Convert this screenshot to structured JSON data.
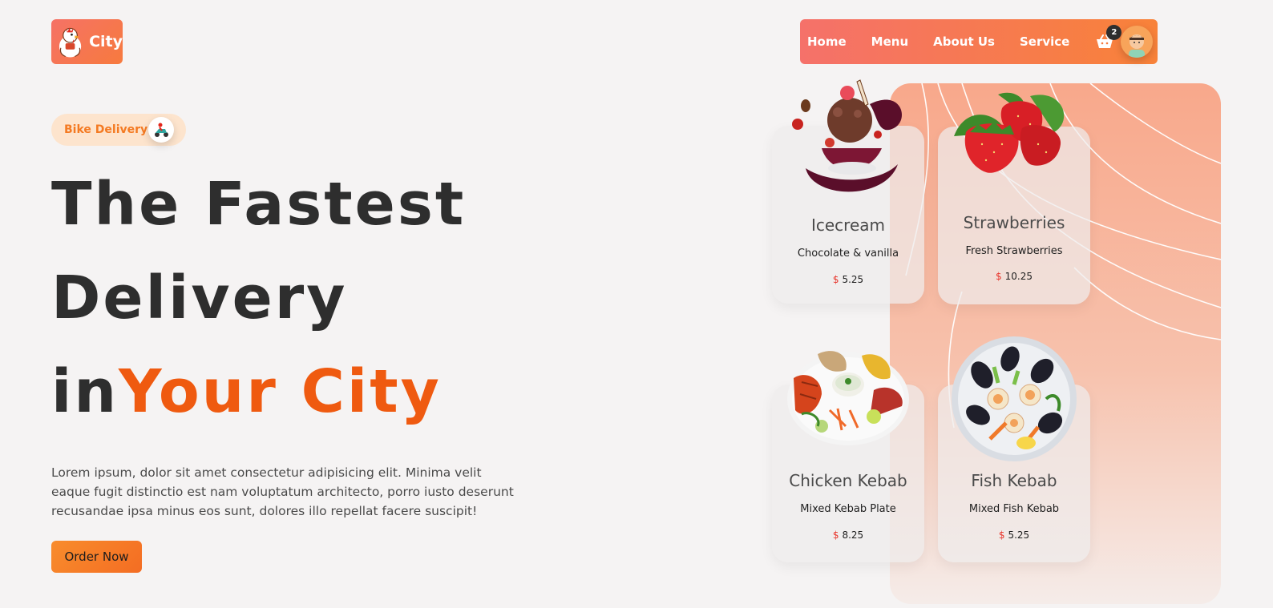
{
  "brand": {
    "name": "City",
    "logo_icon": "chicken-mascot-icon"
  },
  "nav": {
    "links": [
      "Home",
      "Menu",
      "About Us",
      "Service"
    ],
    "cart_count": "2",
    "cart_icon": "basket-icon",
    "avatar_icon": "user-avatar-icon"
  },
  "hero": {
    "badge": "Bike Delivery",
    "badge_icon": "scooter-icon",
    "headline_part1": "The Fastest Delivery in",
    "headline_accent": "Your City",
    "description": "Lorem ipsum, dolor sit amet consectetur adipisicing elit. Minima velit eaque fugit distinctio est nam voluptatum architecto, porro iusto deserunt recusandae ipsa minus eos sunt, dolores illo repellat facere suscipit!",
    "cta": "Order Now"
  },
  "cards": [
    {
      "title": "Icecream",
      "subtitle": "Chocolate & vanilla",
      "currency": "$",
      "price": "5.25",
      "image": "icecream-image"
    },
    {
      "title": "Strawberries",
      "subtitle": "Fresh Strawberries",
      "currency": "$",
      "price": "10.25",
      "image": "strawberries-image"
    },
    {
      "title": "Chicken Kebab",
      "subtitle": "Mixed Kebab Plate",
      "currency": "$",
      "price": "8.25",
      "image": "chicken-kebab-image"
    },
    {
      "title": "Fish Kebab",
      "subtitle": "Mixed Fish Kebab",
      "currency": "$",
      "price": "5.25",
      "image": "fish-kebab-image"
    }
  ],
  "colors": {
    "accent": "#ef5a10",
    "nav_gradient_start": "#f5716a",
    "nav_gradient_end": "#f88239",
    "price_currency": "#e8332a"
  }
}
